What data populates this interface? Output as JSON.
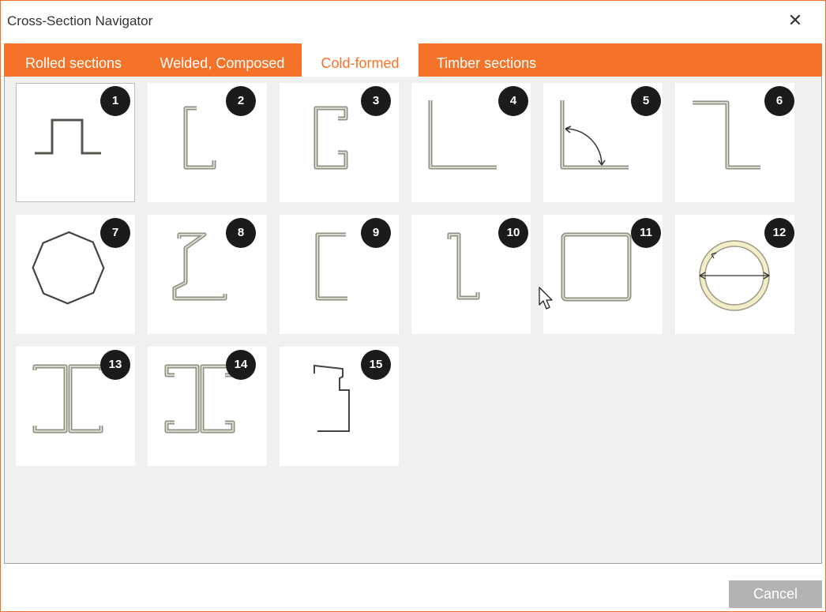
{
  "window": {
    "title": "Cross-Section Navigator",
    "close_icon": "close-icon"
  },
  "tabs": [
    {
      "label": "Rolled sections",
      "active": false
    },
    {
      "label": "Welded, Composed",
      "active": false
    },
    {
      "label": "Cold-formed",
      "active": true
    },
    {
      "label": "Timber sections",
      "active": false
    }
  ],
  "sections": [
    {
      "number": "1",
      "icon": "hat-section-icon"
    },
    {
      "number": "2",
      "icon": "lipped-channel-icon"
    },
    {
      "number": "3",
      "icon": "double-lipped-channel-icon"
    },
    {
      "number": "4",
      "icon": "angle-section-icon"
    },
    {
      "number": "5",
      "icon": "angle-with-arc-icon"
    },
    {
      "number": "6",
      "icon": "z-section-icon"
    },
    {
      "number": "7",
      "icon": "octagon-section-icon"
    },
    {
      "number": "8",
      "icon": "sigma-section-icon"
    },
    {
      "number": "9",
      "icon": "channel-section-icon"
    },
    {
      "number": "10",
      "icon": "lipped-z-section-icon"
    },
    {
      "number": "11",
      "icon": "square-tube-icon"
    },
    {
      "number": "12",
      "icon": "circular-tube-icon"
    },
    {
      "number": "13",
      "icon": "back-to-back-channels-icon"
    },
    {
      "number": "14",
      "icon": "back-to-back-lipped-channels-icon"
    },
    {
      "number": "15",
      "icon": "special-profile-icon"
    }
  ],
  "footer": {
    "cancel_label": "Cancel"
  },
  "colors": {
    "accent": "#f47329",
    "badge": "#1b1b1b",
    "profile": "#8f8f82"
  }
}
